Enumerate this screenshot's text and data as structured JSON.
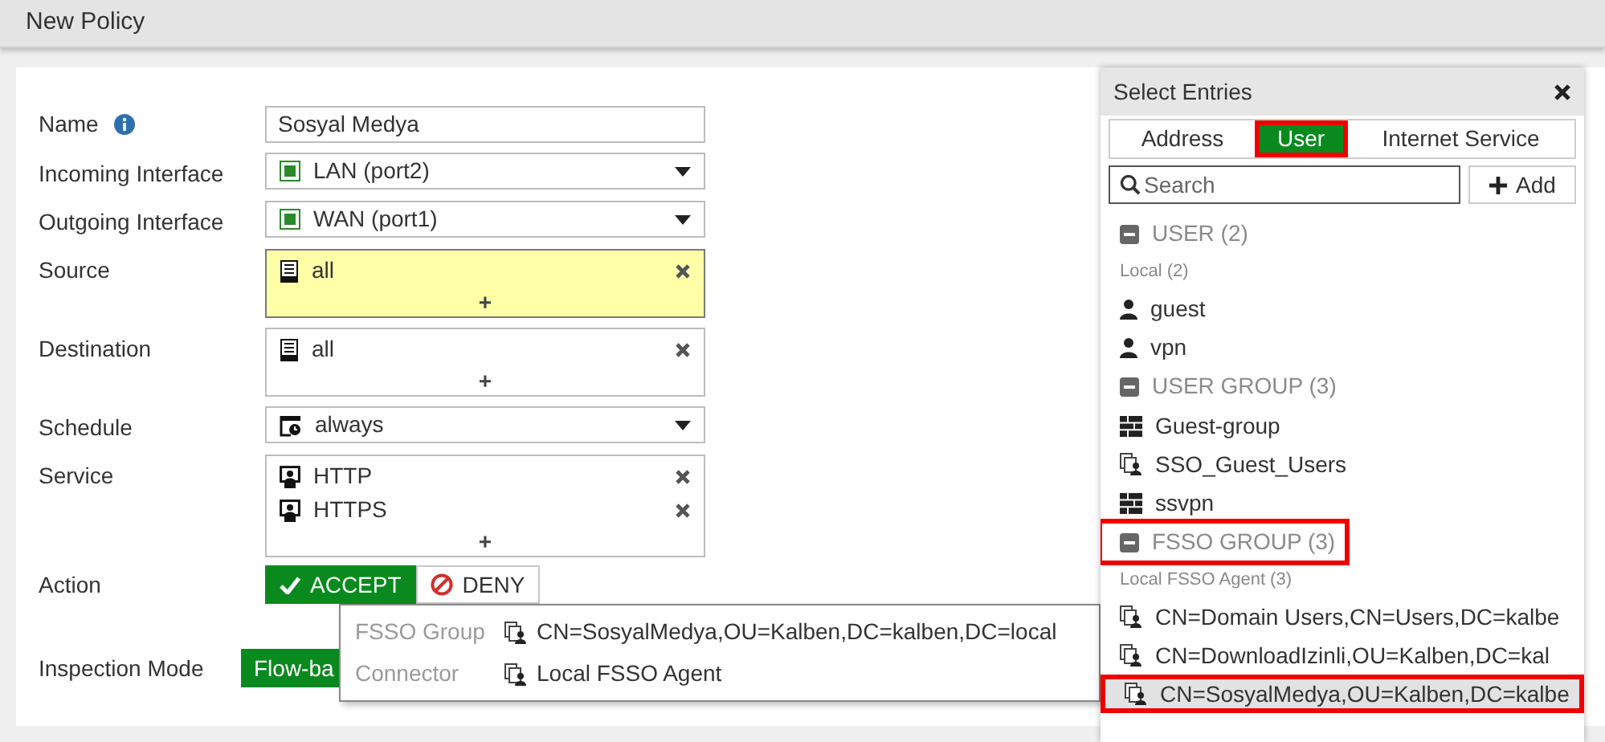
{
  "page_title": "New Policy",
  "form": {
    "name_label": "Name",
    "name_value": "Sosyal Medya",
    "incoming": {
      "label": "Incoming Interface",
      "value": "LAN (port2)"
    },
    "outgoing": {
      "label": "Outgoing Interface",
      "value": "WAN (port1)"
    },
    "source": {
      "label": "Source",
      "highlighted": true,
      "entries": [
        "all"
      ],
      "add": "+"
    },
    "destination": {
      "label": "Destination",
      "highlighted": false,
      "entries": [
        "all"
      ],
      "add": "+"
    },
    "schedule": {
      "label": "Schedule",
      "value": "always"
    },
    "service": {
      "label": "Service",
      "entries": [
        "HTTP",
        "HTTPS"
      ],
      "add": "+"
    },
    "action": {
      "label": "Action",
      "options": [
        {
          "label": "ACCEPT",
          "selected": true
        },
        {
          "label": "DENY",
          "selected": false
        }
      ]
    },
    "inspection": {
      "label": "Inspection Mode",
      "value": "Flow-ba"
    }
  },
  "tooltip": {
    "rows": [
      {
        "label": "FSSO Group",
        "value": "CN=SosyalMedya,OU=Kalben,DC=kalben,DC=local"
      },
      {
        "label": "Connector",
        "value": "Local FSSO Agent"
      }
    ]
  },
  "select_entries": {
    "title": "Select Entries",
    "tabs": [
      {
        "label": "Address",
        "selected": false,
        "highlighted": false
      },
      {
        "label": "User",
        "selected": true,
        "highlighted": true
      },
      {
        "label": "Internet Service",
        "selected": false,
        "highlighted": false
      }
    ],
    "search": {
      "placeholder": "Search"
    },
    "add_button": "Add",
    "groups": [
      {
        "label": "USER (2)",
        "expanded": true,
        "highlighted": false,
        "children": [
          {
            "kind": "subheader",
            "label": "Local (2)"
          },
          {
            "kind": "user",
            "label": "guest",
            "selected": false,
            "highlighted": false
          },
          {
            "kind": "user",
            "label": "vpn",
            "selected": false,
            "highlighted": false
          }
        ]
      },
      {
        "label": "USER GROUP (3)",
        "expanded": true,
        "highlighted": false,
        "children": [
          {
            "kind": "group",
            "label": "Guest-group",
            "selected": false,
            "highlighted": false
          },
          {
            "kind": "fsso",
            "label": "SSO_Guest_Users",
            "selected": false,
            "highlighted": false
          },
          {
            "kind": "group",
            "label": "ssvpn",
            "selected": false,
            "highlighted": false
          }
        ]
      },
      {
        "label": "FSSO GROUP (3)",
        "expanded": true,
        "highlighted": true,
        "children": [
          {
            "kind": "subheader",
            "label": "Local FSSO Agent (3)"
          },
          {
            "kind": "fsso",
            "label": "CN=Domain Users,CN=Users,DC=kalbe",
            "selected": false,
            "highlighted": false
          },
          {
            "kind": "fsso",
            "label": "CN=DownloadIzinli,OU=Kalben,DC=kal",
            "selected": false,
            "highlighted": false
          },
          {
            "kind": "fsso",
            "label": "CN=SosyalMedya,OU=Kalben,DC=kalbe",
            "selected": true,
            "highlighted": true
          }
        ]
      }
    ]
  }
}
